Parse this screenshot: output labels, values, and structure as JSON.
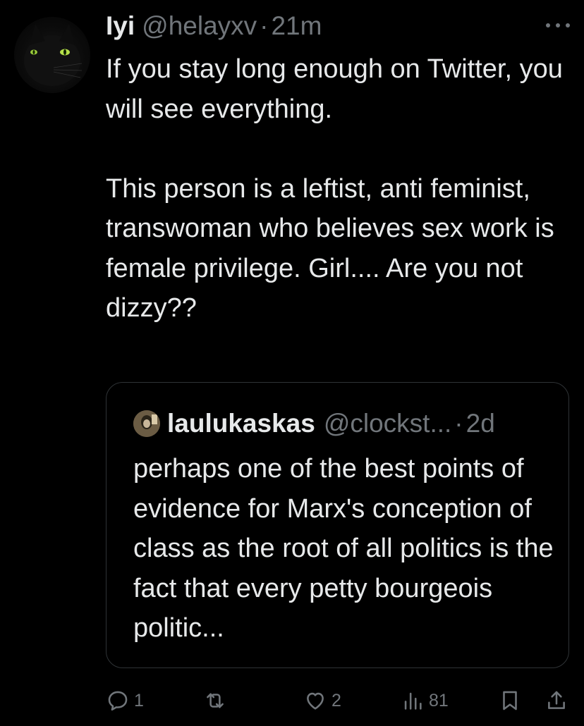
{
  "tweet": {
    "author_name": "Iyi",
    "author_handle": "@helayxv",
    "separator": "·",
    "time": "21m",
    "text": "If you stay long enough on Twitter, you will see everything.\n\nThis person is a leftist, anti feminist, transwoman who believes sex work is female privilege. Girl.... Are you not dizzy??"
  },
  "quote": {
    "author_name": "laulukaskas",
    "author_handle": "@clockst...",
    "separator": "·",
    "time": "2d",
    "text": "perhaps one of the best points of evidence for Marx's conception of class as the root of all politics is the fact that every petty bourgeois politic..."
  },
  "actions": {
    "reply_icon": "reply-icon",
    "reply_count": "1",
    "retweet_icon": "retweet-icon",
    "retweet_count": "",
    "like_icon": "heart-icon",
    "like_count": "2",
    "views_icon": "views-chart-icon",
    "views_count": "81",
    "bookmark_icon": "bookmark-icon",
    "share_icon": "share-icon"
  },
  "colors": {
    "background": "#000000",
    "text_primary": "#e7e9ea",
    "text_secondary": "#71767b",
    "border": "#2f3336"
  }
}
